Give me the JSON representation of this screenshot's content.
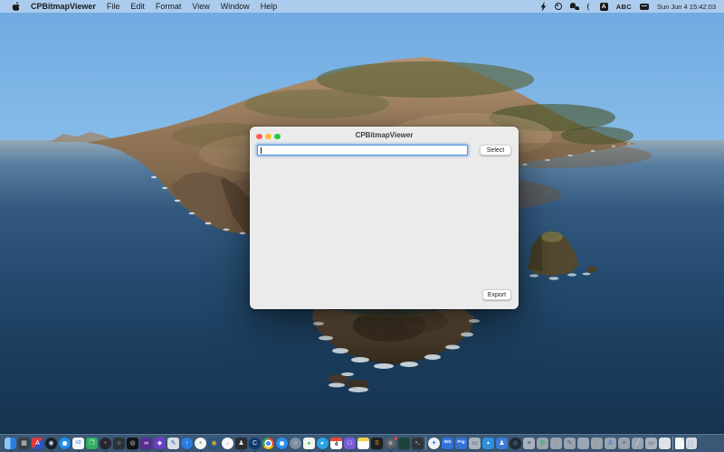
{
  "menu_bar": {
    "app_name": "CPBitmapViewer",
    "items": [
      "File",
      "Edit",
      "Format",
      "View",
      "Window",
      "Help"
    ],
    "input_badge": "A",
    "input_source": "ABC",
    "clock": "Sun Jun 4 15:42:03",
    "status_icons": [
      "bolt-icon",
      "activity-icon",
      "chat-bubbles-icon",
      "moon-icon",
      "input-source-badge",
      "keyboard-switcher-icon"
    ]
  },
  "window": {
    "title": "CPBitmapViewer",
    "path_field": {
      "value": "",
      "placeholder": ""
    },
    "select_button": "Select",
    "export_button": "Export"
  },
  "colors": {
    "focus_ring": "#4f93dc",
    "window_bg": "#ecebeb",
    "menu_bar_bg": "#b0cfee",
    "sea_deep": "#16304e",
    "sky_top": "#6fa8e0",
    "dock_bg": "rgba(110,142,172,0.42)"
  },
  "dock": {
    "icons": [
      {
        "name": "finder",
        "bg": "linear-gradient(90deg,#8ec7f2 49%,#2a7de1 51%)",
        "glyph": "",
        "dot": true
      },
      {
        "name": "launchpad",
        "bg": "#3a3f47",
        "glyph": "▦",
        "glyph_color": "#cfd8e3"
      },
      {
        "name": "red-blue-a-app",
        "bg": "linear-gradient(135deg,#e03b3b 50%,#2a56c6 50%)",
        "glyph": "A",
        "glyph_color": "#ffffff"
      },
      {
        "name": "steam",
        "shape": "ci",
        "bg": "#16202d",
        "glyph": "◉",
        "glyph_color": "#cfd8e3",
        "dot": true
      },
      {
        "name": "safari",
        "shape": "ci",
        "bg": "radial-gradient(circle,#eaf4ff 28%,#1f8df0 30%)"
      },
      {
        "name": "v2rayu",
        "bg": "#f2f6fa",
        "glyph": "V2",
        "glyph_color": "#2a6fd0",
        "glyph_size": 5,
        "dot": true
      },
      {
        "name": "green-cubes-app",
        "bg": "#2fae62",
        "glyph": "❐",
        "glyph_color": "#e8ffe8"
      },
      {
        "name": "dark-sphere-app",
        "shape": "ci",
        "bg": "#23272e",
        "glyph": "●",
        "glyph_color": "#e05555",
        "glyph_size": 5,
        "dot": true
      },
      {
        "name": "hexagon-app",
        "bg": "#2e3338",
        "glyph": "○",
        "glyph_color": "#e8e8e8"
      },
      {
        "name": "black-swirl-app",
        "bg": "#111316",
        "glyph": "◎",
        "glyph_color": "#e8e8e8",
        "dot": true
      },
      {
        "name": "visual-studio",
        "bg": "#5c2d91",
        "glyph": "∞",
        "glyph_color": "#ffffff",
        "dot": true
      },
      {
        "name": "vscode",
        "bg": "#6a3fc0",
        "glyph": "◆",
        "glyph_color": "#cfe2ff",
        "dot": true
      },
      {
        "name": "pen-tool-app",
        "bg": "#d7dee6",
        "glyph": "✎",
        "glyph_color": "#2a62c8"
      },
      {
        "name": "upload-app",
        "shape": "ci",
        "bg": "#2a7de1",
        "glyph": "↑",
        "glyph_color": "#ffffff",
        "dot": true
      },
      {
        "name": "chat-app",
        "shape": "ci",
        "bg": "#f2f6f2",
        "glyph": "●",
        "glyph_color": "#2fae62",
        "glyph_size": 5,
        "dot": true
      },
      {
        "name": "blender",
        "shape": "ci",
        "bg": "#265787",
        "glyph": "◉",
        "glyph_color": "#f5a623"
      },
      {
        "name": "white-dot-app",
        "shape": "ci",
        "bg": "#f5f7f9",
        "glyph": "●",
        "glyph_color": "#f0b429",
        "glyph_size": 4
      },
      {
        "name": "dark-figure-app",
        "bg": "#2c2e33",
        "glyph": "♟",
        "glyph_color": "#e8e8e8",
        "dot": true
      },
      {
        "name": "navy-c-app",
        "shape": "ci",
        "bg": "#0f3a6e",
        "glyph": "C",
        "glyph_color": "#ffffff",
        "dot": true
      },
      {
        "name": "chrome",
        "type": "chrome",
        "shape": "ci"
      },
      {
        "name": "blue-compass-app",
        "shape": "ci",
        "bg": "radial-gradient(circle,#ffffff 26%,#2a8df0 28%)"
      },
      {
        "name": "gray-circle-app",
        "shape": "ci",
        "bg": "#7d8ea0",
        "glyph": "○",
        "glyph_color": "#eef2f6"
      },
      {
        "name": "wechat",
        "bg": "#f2f6f2",
        "glyph": "●",
        "glyph_color": "#2dc100",
        "glyph_size": 6,
        "dot": true
      },
      {
        "name": "telegram",
        "shape": "ci",
        "bg": "#2aa3e3",
        "glyph": "▸",
        "glyph_color": "#ffffff",
        "dot": true
      },
      {
        "name": "calendar",
        "type": "calendar",
        "glyph": "4"
      },
      {
        "name": "purple-app",
        "bg": "#7b5cd6",
        "glyph": "□",
        "glyph_color": "#ffffff",
        "dot": true
      },
      {
        "name": "notes",
        "type": "notes"
      },
      {
        "name": "sublime-text",
        "bg": "#1e1f23",
        "glyph": "S",
        "glyph_color": "#ff9800"
      },
      {
        "name": "gray-knit-app",
        "shape": "ci",
        "bg": "#5a5f66",
        "glyph": "◉",
        "glyph_color": "#9aa4ae",
        "badge": true,
        "dot": true
      },
      {
        "name": "dark-green-app",
        "bg": "#1d4438"
      },
      {
        "name": "terminal",
        "bg": "#30343a",
        "glyph": ">_",
        "glyph_color": "#cfe2cf",
        "glyph_size": 5,
        "dot": true
      },
      {
        "type": "sep",
        "name": "dock-separator-1"
      },
      {
        "name": "accessibility-app",
        "shape": "ci",
        "bg": "#eef2f6",
        "glyph": "✦",
        "glyph_color": "#2a7de1",
        "dot": true
      },
      {
        "name": "folder-ide",
        "type": "folder",
        "label": "IDE"
      },
      {
        "name": "folder-prg",
        "type": "folder",
        "label": "Prg"
      },
      {
        "name": "gray-window-app-1",
        "bg": "#a8b4c0",
        "glyph": "▭",
        "glyph_color": "#454f5c"
      },
      {
        "name": "blue-mountain-app",
        "bg": "#2f8fe0",
        "glyph": "▲",
        "glyph_color": "#ffffff",
        "glyph_size": 5
      },
      {
        "name": "blue-figure-app",
        "bg": "#3a7bd5",
        "glyph": "♟",
        "glyph_color": "#ffffff"
      },
      {
        "name": "dark-lens-app",
        "shape": "ci",
        "bg": "#23272e",
        "glyph": "◎",
        "glyph_color": "#3a9bd5"
      },
      {
        "name": "gray-window-app-2",
        "bg": "#a8b2bd",
        "glyph": "≡",
        "glyph_color": "#4a5568"
      },
      {
        "name": "gray-gear-app",
        "bg": "#98a4b0",
        "glyph": "⚙",
        "glyph_color": "#2fae62"
      },
      {
        "name": "gray-nodes-app",
        "bg": "#98a4b0",
        "glyph": "*",
        "glyph_color": "#e07b39"
      },
      {
        "name": "gray-brush-app",
        "bg": "#98a4b0",
        "glyph": "✎",
        "glyph_color": "#5a6570"
      },
      {
        "name": "gray-plain-app",
        "bg": "#9aa6b2"
      },
      {
        "name": "gray-key-app",
        "bg": "#98a4b0",
        "glyph": "╱",
        "glyph_color": "#c8922a"
      },
      {
        "name": "gray-a-tool-app",
        "bg": "#98a4b0",
        "glyph": "A",
        "glyph_color": "#2a7de1"
      },
      {
        "name": "gray-disks-app",
        "bg": "#98a4b0",
        "glyph": "≡",
        "glyph_color": "#5a6570"
      },
      {
        "name": "gray-slash-app",
        "bg": "#98a4b0",
        "glyph": "╱",
        "glyph_color": "#e8e8e8"
      },
      {
        "name": "gray-window-app-3",
        "bg": "#a8b2bd",
        "glyph": "▭",
        "glyph_color": "#454f5c"
      },
      {
        "name": "light-rounded-app",
        "bg": "#dde3e8"
      },
      {
        "type": "sep",
        "name": "dock-separator-2"
      },
      {
        "name": "document",
        "type": "file"
      },
      {
        "name": "trash",
        "type": "trash"
      }
    ]
  }
}
